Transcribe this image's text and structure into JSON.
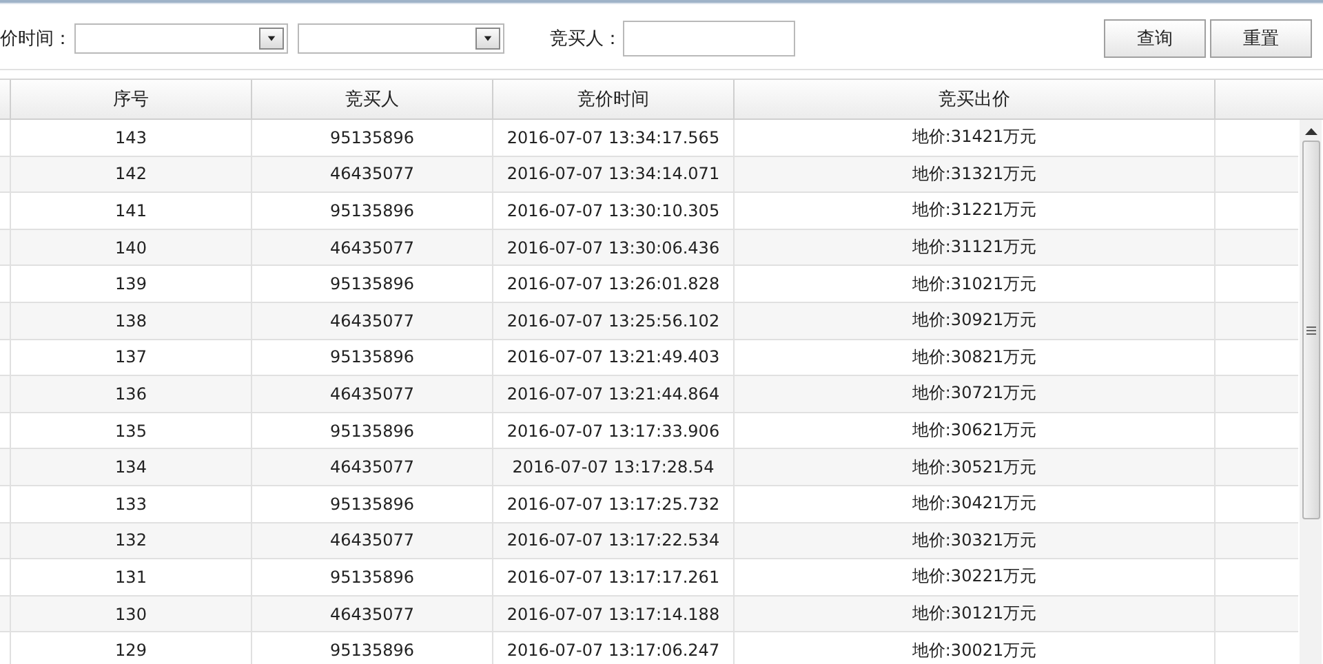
{
  "filters": {
    "time_label": "价时间：",
    "bidder_label": "竞买人："
  },
  "buttons": [
    "查询",
    "重置"
  ],
  "table": {
    "columns": [
      "序号",
      "竞买人",
      "竞价时间",
      "竞买出价"
    ],
    "rows": [
      [
        "143",
        "95135896",
        "2016-07-07 13:34:17.565",
        "地价:31421万元"
      ],
      [
        "142",
        "46435077",
        "2016-07-07 13:34:14.071",
        "地价:31321万元"
      ],
      [
        "141",
        "95135896",
        "2016-07-07 13:30:10.305",
        "地价:31221万元"
      ],
      [
        "140",
        "46435077",
        "2016-07-07 13:30:06.436",
        "地价:31121万元"
      ],
      [
        "139",
        "95135896",
        "2016-07-07 13:26:01.828",
        "地价:31021万元"
      ],
      [
        "138",
        "46435077",
        "2016-07-07 13:25:56.102",
        "地价:30921万元"
      ],
      [
        "137",
        "95135896",
        "2016-07-07 13:21:49.403",
        "地价:30821万元"
      ],
      [
        "136",
        "46435077",
        "2016-07-07 13:21:44.864",
        "地价:30721万元"
      ],
      [
        "135",
        "95135896",
        "2016-07-07 13:17:33.906",
        "地价:30621万元"
      ],
      [
        "134",
        "46435077",
        "2016-07-07 13:17:28.54",
        "地价:30521万元"
      ],
      [
        "133",
        "95135896",
        "2016-07-07 13:17:25.732",
        "地价:30421万元"
      ],
      [
        "132",
        "46435077",
        "2016-07-07 13:17:22.534",
        "地价:30321万元"
      ],
      [
        "131",
        "95135896",
        "2016-07-07 13:17:17.261",
        "地价:30221万元"
      ],
      [
        "130",
        "46435077",
        "2016-07-07 13:17:14.188",
        "地价:30121万元"
      ],
      [
        "129",
        "95135896",
        "2016-07-07 13:17:06.247",
        "地价:30021万元"
      ]
    ]
  }
}
